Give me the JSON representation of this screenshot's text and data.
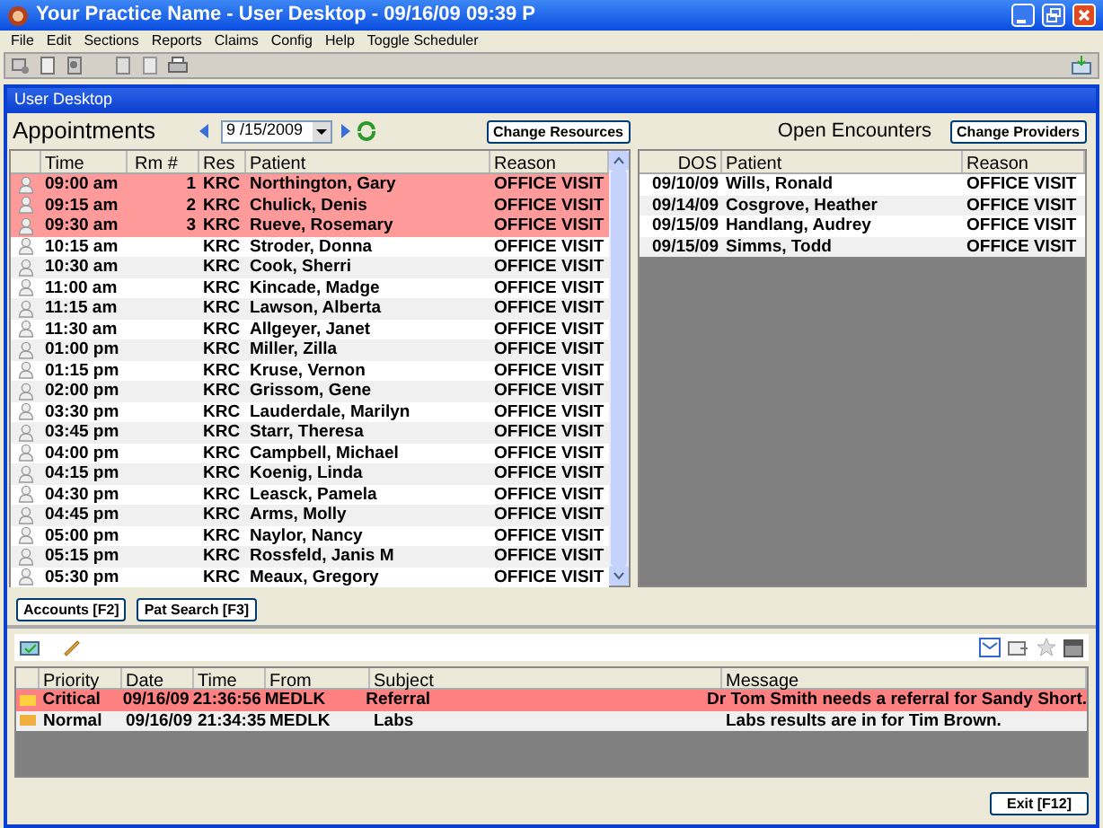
{
  "window": {
    "title": "Your Practice Name -  User Desktop - 09/16/09 09:39 P"
  },
  "menu": [
    "File",
    "Edit",
    "Sections",
    "Reports",
    "Claims",
    "Config",
    "Help",
    "Toggle Scheduler"
  ],
  "inner_title": "User Desktop",
  "appointments": {
    "title": "Appointments",
    "date": "9 /15/2009",
    "change_button": "Change Resources",
    "columns": [
      "Time",
      "Rm #",
      "Res",
      "Patient",
      "Reason"
    ],
    "rows": [
      {
        "time": "09:00 am",
        "room": "1",
        "res": "KRC",
        "patient": "Northington, Gary",
        "reason": "OFFICE VISIT",
        "highlighted": true
      },
      {
        "time": "09:15 am",
        "room": "2",
        "res": "KRC",
        "patient": "Chulick, Denis",
        "reason": "OFFICE VISIT",
        "highlighted": true
      },
      {
        "time": "09:30 am",
        "room": "3",
        "res": "KRC",
        "patient": "Rueve, Rosemary",
        "reason": "OFFICE VISIT",
        "highlighted": true
      },
      {
        "time": "10:15 am",
        "res": "KRC",
        "patient": "Stroder, Donna",
        "reason": "OFFICE VISIT",
        "highlighted": false
      },
      {
        "time": "10:30 am",
        "res": "KRC",
        "patient": "Cook, Sherri",
        "reason": "OFFICE VISIT",
        "highlighted": false
      },
      {
        "time": "11:00 am",
        "res": "KRC",
        "patient": "Kincade, Madge",
        "reason": "OFFICE VISIT",
        "highlighted": false
      },
      {
        "time": "11:15 am",
        "res": "KRC",
        "patient": "Lawson, Alberta",
        "reason": "OFFICE VISIT",
        "highlighted": false
      },
      {
        "time": "11:30 am",
        "res": "KRC",
        "patient": "Allgeyer, Janet",
        "reason": "OFFICE VISIT",
        "highlighted": false
      },
      {
        "time": "01:00 pm",
        "res": "KRC",
        "patient": "Miller, Zilla",
        "reason": "OFFICE VISIT",
        "highlighted": false
      },
      {
        "time": "01:15 pm",
        "res": "KRC",
        "patient": "Kruse, Vernon",
        "reason": "OFFICE VISIT",
        "highlighted": false
      },
      {
        "time": "02:00 pm",
        "res": "KRC",
        "patient": "Grissom, Gene",
        "reason": "OFFICE VISIT",
        "highlighted": false
      },
      {
        "time": "03:30 pm",
        "res": "KRC",
        "patient": "Lauderdale, Marilyn",
        "reason": "OFFICE VISIT",
        "highlighted": false
      },
      {
        "time": "03:45 pm",
        "res": "KRC",
        "patient": "Starr, Theresa",
        "reason": "OFFICE VISIT",
        "highlighted": false
      },
      {
        "time": "04:00 pm",
        "res": "KRC",
        "patient": "Campbell, Michael",
        "reason": "OFFICE VISIT",
        "highlighted": false
      },
      {
        "time": "04:15 pm",
        "res": "KRC",
        "patient": "Koenig, Linda",
        "reason": "OFFICE VISIT",
        "highlighted": false
      },
      {
        "time": "04:30 pm",
        "res": "KRC",
        "patient": "Leasck, Pamela",
        "reason": "OFFICE VISIT",
        "highlighted": false
      },
      {
        "time": "04:45 pm",
        "res": "KRC",
        "patient": "Arms, Molly",
        "reason": "OFFICE VISIT",
        "highlighted": false
      },
      {
        "time": "05:00 pm",
        "res": "KRC",
        "patient": "Naylor, Nancy",
        "reason": "OFFICE VISIT",
        "highlighted": false
      },
      {
        "time": "05:15 pm",
        "res": "KRC",
        "patient": "Rossfeld, Janis M",
        "reason": "OFFICE VISIT",
        "highlighted": false
      },
      {
        "time": "05:30 pm",
        "res": "KRC",
        "patient": "Meaux, Gregory",
        "reason": "OFFICE VISIT",
        "highlighted": false
      }
    ],
    "buttons": [
      "Accounts [F2]",
      "Pat Search [F3]"
    ]
  },
  "open_encounters": {
    "title": "Open Encounters",
    "change_button": "Change Providers",
    "columns": [
      "DOS",
      "Patient",
      "Reason"
    ],
    "rows": [
      {
        "dos": "09/10/09",
        "patient": "Wills, Ronald",
        "reason": "OFFICE VISIT"
      },
      {
        "dos": "09/14/09",
        "patient": "Cosgrove, Heather",
        "reason": "OFFICE VISIT"
      },
      {
        "dos": "09/15/09",
        "patient": "Handlang, Audrey",
        "reason": "OFFICE VISIT"
      },
      {
        "dos": "09/15/09",
        "patient": "Simms, Todd",
        "reason": "OFFICE VISIT"
      }
    ]
  },
  "messages": {
    "columns": [
      "Priority",
      "Date",
      "Time",
      "From",
      "Subject",
      "Message"
    ],
    "rows": [
      {
        "priority": "Critical",
        "date": "09/16/09",
        "time": "21:36:56",
        "from": "MEDLK",
        "subject": "Referral",
        "message": "Dr Tom Smith needs a referral for Sandy Short.",
        "highlighted": true
      },
      {
        "priority": "Normal",
        "date": "09/16/09",
        "time": "21:34:35",
        "from": "MEDLK",
        "subject": "Labs",
        "message": "Labs results are in for Tim Brown.",
        "highlighted": false
      }
    ]
  },
  "exit_button": "Exit [F12]"
}
